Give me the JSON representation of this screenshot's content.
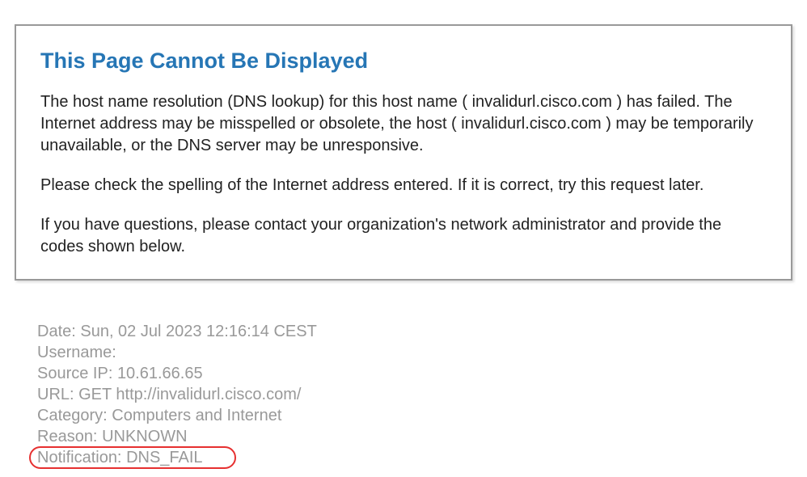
{
  "colors": {
    "title": "#2676b5",
    "body_text": "#222222",
    "meta_text": "#999999",
    "border": "#999999",
    "highlight": "#e63030"
  },
  "error": {
    "title": "This Page Cannot Be Displayed",
    "paragraph1": "The host name resolution (DNS lookup) for this host name ( invalidurl.cisco.com ) has failed. The Internet address may be misspelled or obsolete, the host ( invalidurl.cisco.com ) may be temporarily unavailable, or the DNS server may be unresponsive.",
    "paragraph2": "Please check the spelling of the Internet address entered. If it is correct, try this request later.",
    "paragraph3": "If you have questions, please contact your organization's network administrator and provide the codes shown below."
  },
  "meta": {
    "date_label": "Date: ",
    "date_value": "Sun, 02 Jul 2023 12:16:14 CEST",
    "username_label": "Username:",
    "username_value": "",
    "sourceip_label": "Source IP: ",
    "sourceip_value": "10.61.66.65",
    "url_label": "URL: ",
    "url_value": "GET http://invalidurl.cisco.com/",
    "category_label": "Category: ",
    "category_value": "Computers and Internet",
    "reason_label": "Reason: ",
    "reason_value": "UNKNOWN",
    "notification_label": "Notification: ",
    "notification_value": "DNS_FAIL"
  }
}
